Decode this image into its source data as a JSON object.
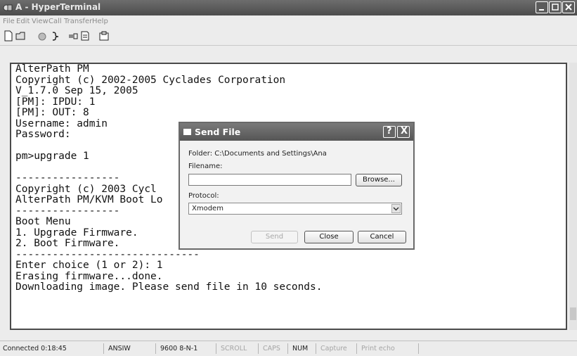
{
  "window": {
    "title": "A - HyperTerminal"
  },
  "menu": [
    "File",
    "Edit",
    "View",
    "Call",
    "Transfer",
    "Help"
  ],
  "toolbar": {
    "icons": [
      "new-icon",
      "open-icon",
      "disconnect-icon",
      "dial-icon",
      "send-receive-icon",
      "capture-icon",
      "properties-icon"
    ]
  },
  "terminal": {
    "lines": [
      "AlterPath PM",
      "Copyright (c) 2002-2005 Cyclades Corporation",
      "V_1.7.0 Sep 15, 2005",
      "[PM]: IPDU: 1",
      "[PM]: OUT: 8",
      "Username: admin",
      "Password:",
      "",
      "pm>upgrade 1",
      "",
      "-----------------",
      "Copyright (c) 2003 Cycl",
      "AlterPath PM/KVM Boot Lo",
      "-----------------",
      "Boot Menu",
      "1. Upgrade Firmware.",
      "2. Boot Firmware.",
      "------------------------------",
      "Enter choice (1 or 2): 1",
      "Erasing firmware...done.",
      "Downloading image. Please send file in 10 seconds."
    ]
  },
  "dialog": {
    "title": "Send File",
    "help_label": "?",
    "close_label": "X",
    "folder_text": "Folder: C:\\Documents and Settings\\Ana",
    "filename_label": "Filename:",
    "filename_value": "",
    "browse_label": "Browse...",
    "protocol_label": "Protocol:",
    "protocol_value": "Xmodem",
    "send_label": "Send",
    "close_button_label": "Close",
    "cancel_label": "Cancel"
  },
  "status": {
    "connected": "Connected 0:18:45",
    "emulation": "ANSIW",
    "settings": "9600 8-N-1",
    "scroll": "SCROLL",
    "caps": "CAPS",
    "num": "NUM",
    "capture": "Capture",
    "print_echo": "Print echo"
  }
}
